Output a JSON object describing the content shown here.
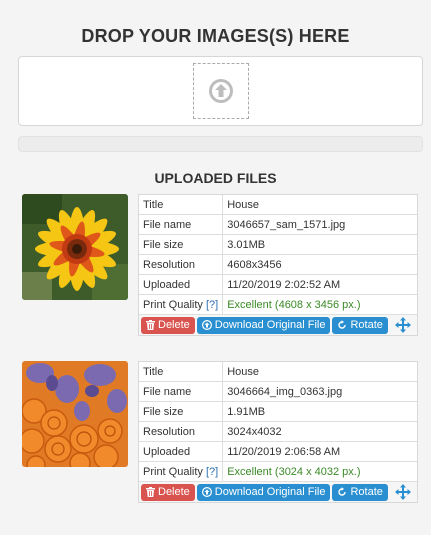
{
  "header": {
    "drop_title": "DROP YOUR IMAGES(S) HERE",
    "uploaded_title": "UPLOADED FILES"
  },
  "dropzone": {
    "icon": "upload-arrow-icon"
  },
  "upload_progress": 0,
  "files": [
    {
      "rows": [
        {
          "key": "Title",
          "value": "House"
        },
        {
          "key": "File name",
          "value": "3046657_sam_1571.jpg"
        },
        {
          "key": "File size",
          "value": "3.01MB"
        },
        {
          "key": "Resolution",
          "value": "4608x3456"
        },
        {
          "key": "Uploaded",
          "value": "11/20/2019 2:02:52 AM"
        }
      ],
      "quality": {
        "key": "Print Quality",
        "help": "[?]",
        "value": "Excellent (4608 x 3456 px.)"
      },
      "thumbnail": "yellow-flower-photo"
    },
    {
      "rows": [
        {
          "key": "Title",
          "value": "House"
        },
        {
          "key": "File name",
          "value": "3046664_img_0363.jpg"
        },
        {
          "key": "File size",
          "value": "1.91MB"
        },
        {
          "key": "Resolution",
          "value": "3024x4032"
        },
        {
          "key": "Uploaded",
          "value": "11/20/2019 2:06:58 AM"
        }
      ],
      "quality": {
        "key": "Print Quality",
        "help": "[?]",
        "value": "Excellent (3024 x 4032 px.)"
      },
      "thumbnail": "orange-roses-photo"
    }
  ],
  "actions": {
    "delete_label": "Delete",
    "download_label": "Download Original File",
    "rotate_label": "Rotate"
  },
  "colors": {
    "delete": "#d9534f",
    "primary": "#2a8fd0",
    "quality_text": "#3a8a26"
  }
}
